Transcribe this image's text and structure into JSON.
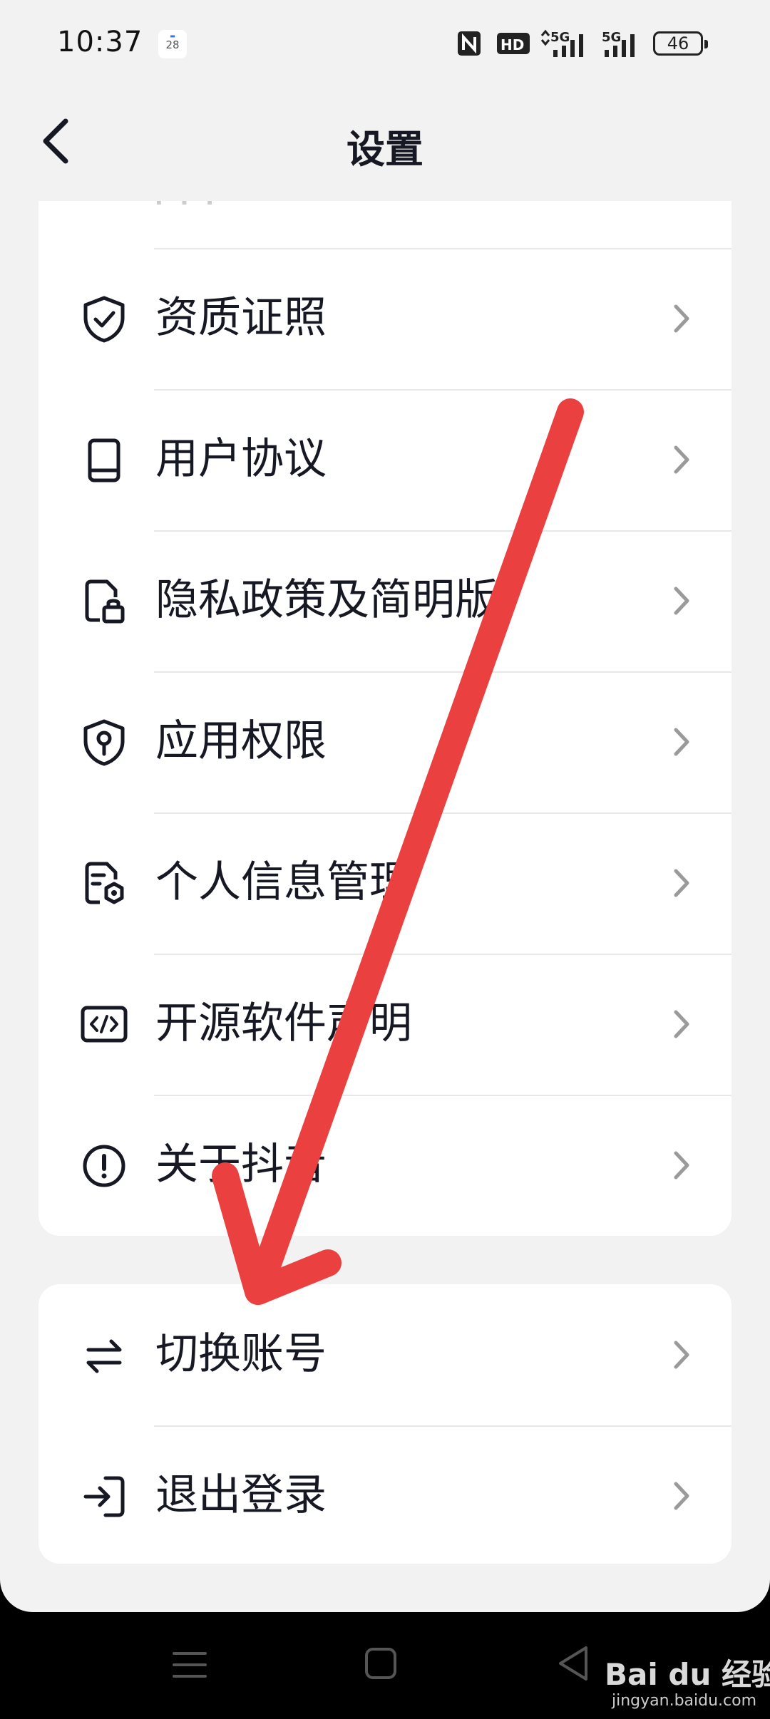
{
  "status_bar": {
    "time": "10:37",
    "calendar_day": "28",
    "network_1": "5G",
    "network_2": "5G",
    "hd_label": "HD",
    "battery": "46"
  },
  "header": {
    "title": "设置"
  },
  "menu_group_1": [
    {
      "label": "资质证照",
      "icon": "shield-check-icon"
    },
    {
      "label": "用户协议",
      "icon": "book-icon"
    },
    {
      "label": "隐私政策及简明版",
      "icon": "document-lock-icon"
    },
    {
      "label": "应用权限",
      "icon": "shield-key-icon"
    },
    {
      "label": "个人信息管理",
      "icon": "document-gear-icon"
    },
    {
      "label": "开源软件声明",
      "icon": "code-icon"
    },
    {
      "label": "关于抖音",
      "icon": "info-exclamation-icon"
    }
  ],
  "menu_group_2": [
    {
      "label": "切换账号",
      "icon": "swap-arrows-icon"
    },
    {
      "label": "退出登录",
      "icon": "logout-icon"
    }
  ],
  "watermark": {
    "brand": "Bai du 经验",
    "url": "jingyan.baidu.com"
  },
  "colors": {
    "background": "#f2f2f2",
    "card": "#ffffff",
    "text": "#161823",
    "chevron": "#9a9a9a",
    "annotation_arrow": "#ea4040"
  }
}
